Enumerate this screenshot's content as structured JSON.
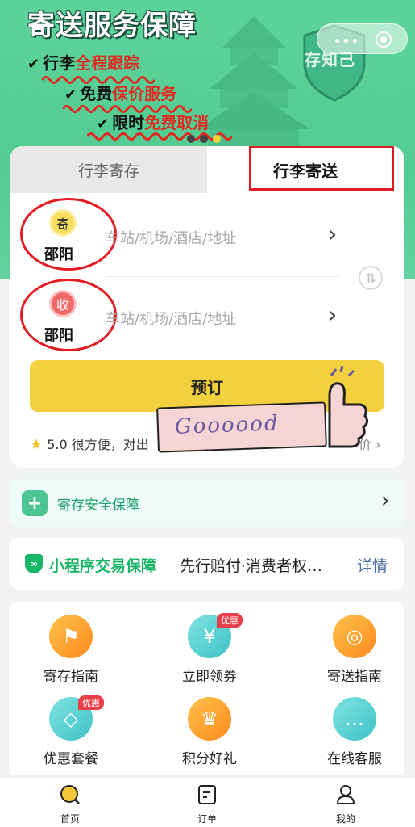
{
  "banner": {
    "title": "寄送服务保障",
    "features": [
      {
        "prefix": "行李",
        "highlight": "全程跟踪"
      },
      {
        "prefix": "免费",
        "highlight": "保价服务"
      },
      {
        "prefix": "限时",
        "highlight": "免费取消"
      }
    ],
    "shield_text": "存知己"
  },
  "capsule": {
    "more_icon": "more-dots-icon",
    "close_icon": "target-icon"
  },
  "tabs": {
    "storage": "行李寄存",
    "delivery": "行李寄送"
  },
  "send": {
    "badge": "寄",
    "city": "邵阳",
    "placeholder": "车站/机场/酒店/地址"
  },
  "receive": {
    "badge": "收",
    "city": "邵阳",
    "placeholder": "车站/机场/酒店/地址"
  },
  "book_button": "预订",
  "review": {
    "rating": "5.0",
    "text": "很方便，对出",
    "tail": "价"
  },
  "sticker_text": "Goooood",
  "safety": {
    "label": "寄存安全保障"
  },
  "guarantee": {
    "title": "小程序交易保障",
    "desc": "先行赔付·消费者权…",
    "link": "详情"
  },
  "services": [
    {
      "label": "寄存指南",
      "icon": "signpost-icon",
      "tag": ""
    },
    {
      "label": "立即领券",
      "icon": "coupon-icon",
      "tag": "优惠"
    },
    {
      "label": "寄送指南",
      "icon": "compass-icon",
      "tag": ""
    },
    {
      "label": "优惠套餐",
      "icon": "tag-icon",
      "tag": "优惠"
    },
    {
      "label": "积分好礼",
      "icon": "crown-icon",
      "tag": ""
    },
    {
      "label": "在线客服",
      "icon": "chat-icon",
      "tag": ""
    }
  ],
  "nav": {
    "home": "首页",
    "orders": "订单",
    "mine": "我的"
  },
  "colors": {
    "accent_green": "#52cc92",
    "button_yellow": "#f3d03e",
    "highlight_red": "#e31b23"
  }
}
